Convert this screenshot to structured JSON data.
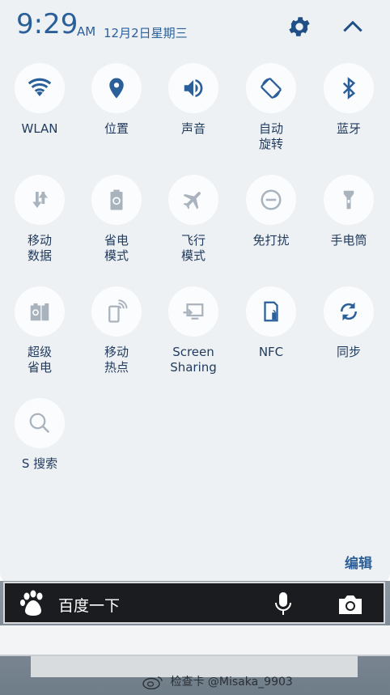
{
  "status": {
    "time": "9:29",
    "ampm": "AM",
    "date": "12月2日星期三"
  },
  "tiles": [
    {
      "label": "WLAN",
      "icon": "wifi-icon"
    },
    {
      "label": "位置",
      "icon": "location-icon"
    },
    {
      "label": "声音",
      "icon": "sound-icon"
    },
    {
      "label": "自动\n旋转",
      "icon": "rotate-icon"
    },
    {
      "label": "蓝牙",
      "icon": "bluetooth-icon"
    },
    {
      "label": "移动\n数据",
      "icon": "mobile-data-icon"
    },
    {
      "label": "省电\n模式",
      "icon": "power-saving-icon"
    },
    {
      "label": "飞行\n模式",
      "icon": "airplane-icon"
    },
    {
      "label": "免打扰",
      "icon": "do-not-disturb-icon"
    },
    {
      "label": "手电筒",
      "icon": "flashlight-icon"
    },
    {
      "label": "超级\n省电",
      "icon": "ultra-power-saving-icon"
    },
    {
      "label": "移动\n热点",
      "icon": "hotspot-icon"
    },
    {
      "label": "Screen\nSharing",
      "icon": "screen-sharing-icon"
    },
    {
      "label": "NFC",
      "icon": "nfc-icon"
    },
    {
      "label": "同步",
      "icon": "sync-icon"
    },
    {
      "label": "S 搜索",
      "icon": "s-search-icon"
    }
  ],
  "edit_label": "编辑",
  "search_widget": {
    "text": "百度一下"
  },
  "watermark": {
    "text": "检查卡 @Misaka_9903"
  },
  "colors": {
    "accent": "#2a5f9a",
    "panel_bg": "#eef1f4",
    "tile_bg": "#fbfcfd",
    "active_icon": "#2a5f9a",
    "inactive_icon": "#a9b3bd"
  }
}
